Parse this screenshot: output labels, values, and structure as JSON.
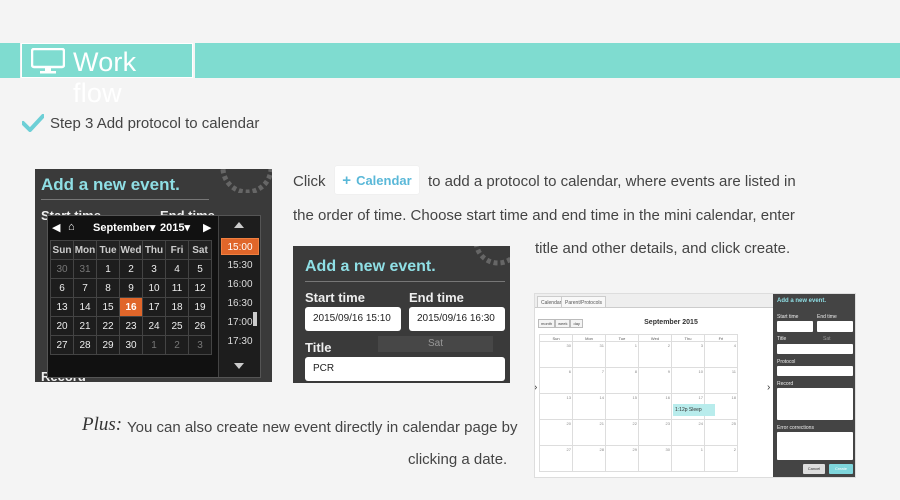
{
  "header": {
    "title": "Work flow",
    "icon": "monitor-icon"
  },
  "step": {
    "text": "Step  3 Add protocol to calendar",
    "icon": "checkmark-icon"
  },
  "calendar_button": {
    "label": "Calendar",
    "icon": "plus-icon",
    "color": "#5ab8d8"
  },
  "description": {
    "line1_pre": "Click",
    "line1_post": "to add a protocol to calendar, where events are listed in",
    "line2": "the order of time. Choose start time and end time in the mini calendar, enter",
    "line3": "title  and other details, and click create."
  },
  "shot1": {
    "heading": "Add a new event.",
    "start_label": "Start time",
    "end_label": "End time",
    "record_label": "Record",
    "month": "September",
    "year": "2015",
    "weekdays": [
      "Sun",
      "Mon",
      "Tue",
      "Wed",
      "Thu",
      "Fri",
      "Sat"
    ],
    "weeks": [
      [
        "30",
        "31",
        "1",
        "2",
        "3",
        "4",
        "5"
      ],
      [
        "6",
        "7",
        "8",
        "9",
        "10",
        "11",
        "12"
      ],
      [
        "13",
        "14",
        "15",
        "16",
        "17",
        "18",
        "19"
      ],
      [
        "20",
        "21",
        "22",
        "23",
        "24",
        "25",
        "26"
      ],
      [
        "27",
        "28",
        "29",
        "30",
        "1",
        "2",
        "3"
      ]
    ],
    "selected_day": "16",
    "times": [
      "15:00",
      "15:30",
      "16:00",
      "16:30",
      "17:00",
      "17:30"
    ],
    "selected_time": "15:00"
  },
  "shot2": {
    "heading": "Add a new event.",
    "start_label": "Start time",
    "start_value": "2015/09/16 15:10",
    "end_label": "End time",
    "end_value": "2015/09/16 16:30",
    "title_label": "Title",
    "title_value": "PCR",
    "ghost": "Sat"
  },
  "shot3": {
    "tabs": [
      "Calendar",
      "Parent/Protocols"
    ],
    "views": [
      "month",
      "week",
      "day"
    ],
    "month_title": "September 2015",
    "weekdays": [
      "Sun",
      "Mon",
      "Tue",
      "Wed",
      "Thu",
      "Fri"
    ],
    "weeks": [
      [
        "30",
        "31",
        "1",
        "2",
        "3",
        "4"
      ],
      [
        "6",
        "7",
        "8",
        "9",
        "10",
        "11"
      ],
      [
        "13",
        "14",
        "15",
        "16",
        "17",
        "18"
      ],
      [
        "20",
        "21",
        "22",
        "23",
        "24",
        "25"
      ],
      [
        "27",
        "28",
        "29",
        "30",
        "1",
        "2"
      ]
    ],
    "event": "1:12p  Sleep",
    "side": {
      "heading": "Add a new event.",
      "start": "Start time",
      "end": "End time",
      "title": "Title",
      "ghost": "Sat",
      "protocol": "Protocol",
      "record": "Record",
      "errors": "Error corrections",
      "cancel": "Cancel",
      "create": "Create"
    }
  },
  "plus": {
    "label": "Plus:",
    "line1": "You can also create new event directly in calendar page by",
    "line2": "clicking a date."
  },
  "colors": {
    "accent": "#7fdcd0",
    "highlight": "#e0662a",
    "heading_cyan": "#8fdfe5"
  }
}
